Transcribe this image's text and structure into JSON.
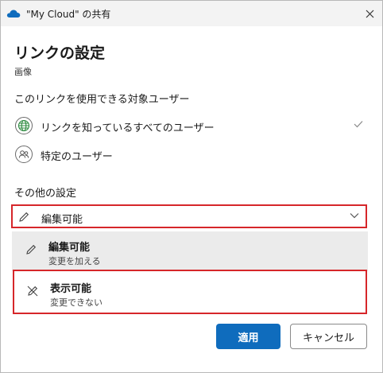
{
  "window": {
    "title": "\"My Cloud\" の共有",
    "close_icon": "close-icon"
  },
  "heading": "リンクの設定",
  "subtitle": "画像",
  "audience": {
    "label": "このリンクを使用できる対象ユーザー",
    "options": [
      {
        "label": "リンクを知っているすべてのユーザー",
        "icon": "globe-icon",
        "checked": true
      },
      {
        "label": "特定のユーザー",
        "icon": "people-icon",
        "checked": false
      }
    ]
  },
  "other_settings": {
    "label": "その他の設定",
    "permission_select": {
      "value": "編集可能",
      "icon": "pencil-icon"
    },
    "dropdown": [
      {
        "title": "編集可能",
        "description": "変更を加える",
        "icon": "pencil-icon",
        "selected": true
      },
      {
        "title": "表示可能",
        "description": "変更できない",
        "icon": "pencil-off-icon",
        "selected": false
      }
    ]
  },
  "buttons": {
    "apply": "適用",
    "cancel": "キャンセル"
  },
  "colors": {
    "accent": "#0f6cbd",
    "highlight_border": "#d6262a",
    "selected_bg": "#ebebeb"
  }
}
